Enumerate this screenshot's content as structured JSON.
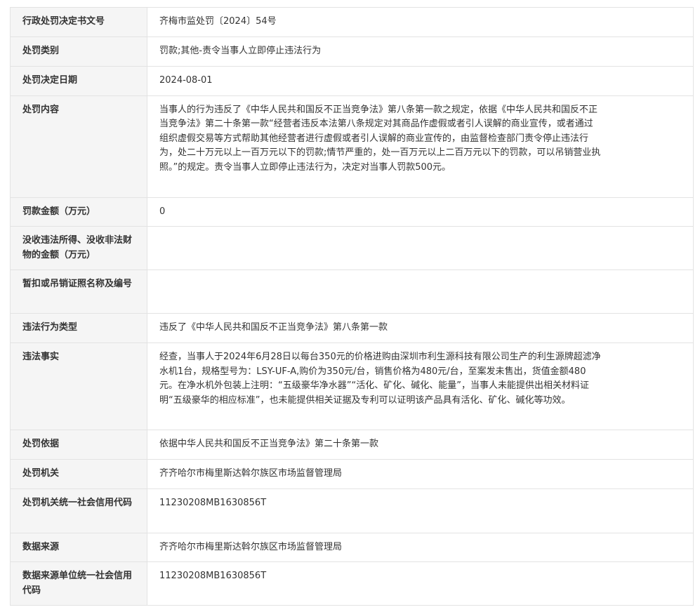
{
  "rows": [
    {
      "label": "行政处罚决定书文号",
      "value": "齐梅市监处罚〔2024〕54号"
    },
    {
      "label": "处罚类别",
      "value": "罚款;其他-责令当事人立即停止违法行为"
    },
    {
      "label": "处罚决定日期",
      "value": "2024-08-01"
    },
    {
      "label": "处罚内容",
      "value": "当事人的行为违反了《中华人民共和国反不正当竞争法》第八条第一款之规定，依据《中华人民共和国反不正当竞争法》第二十条第一款“经营者违反本法第八条规定对其商品作虚假或者引人误解的商业宣传，或者通过组织虚假交易等方式帮助其他经营者进行虚假或者引人误解的商业宣传的，由监督检查部门责令停止违法行为，处二十万元以上一百万元以下的罚款;情节严重的，处一百万元以上二百万元以下的罚款，可以吊销营业执照。”的规定。责令当事人立即停止违法行为，决定对当事人罚款500元。"
    },
    {
      "label": "罚款金额（万元）",
      "value": "0"
    },
    {
      "label": "没收违法所得、没收非法财物的金额（万元）",
      "value": ""
    },
    {
      "label": "暂扣或吊销证照名称及编号",
      "value": ""
    },
    {
      "label": "违法行为类型",
      "value": "违反了《中华人民共和国反不正当竞争法》第八条第一款"
    },
    {
      "label": "违法事实",
      "value": "经查，当事人于2024年6月28日以每台350元的价格进购由深圳市利生源科技有限公司生产的利生源牌超滤净水机1台，规格型号为：LSY-UF-A,购价为350元/台，销售价格为480元/台，至案发未售出，货值金额480元。在净水机外包装上注明：“五级豪华净水器”“活化、矿化、碱化、能量”，当事人未能提供出相关材料证明“五级豪华的相应标准”，也未能提供相关证据及专利可以证明该产品具有活化、矿化、碱化等功效。"
    },
    {
      "label": "处罚依据",
      "value": "依据中华人民共和国反不正当竞争法》第二十条第一款"
    },
    {
      "label": "处罚机关",
      "value": "齐齐哈尔市梅里斯达斡尔族区市场监督管理局"
    },
    {
      "label": "处罚机关统一社会信用代码",
      "value": "11230208MB1630856T"
    },
    {
      "label": "数据来源",
      "value": "齐齐哈尔市梅里斯达斡尔族区市场监督管理局"
    },
    {
      "label": "数据来源单位统一社会信用代码",
      "value": "11230208MB1630856T"
    }
  ]
}
